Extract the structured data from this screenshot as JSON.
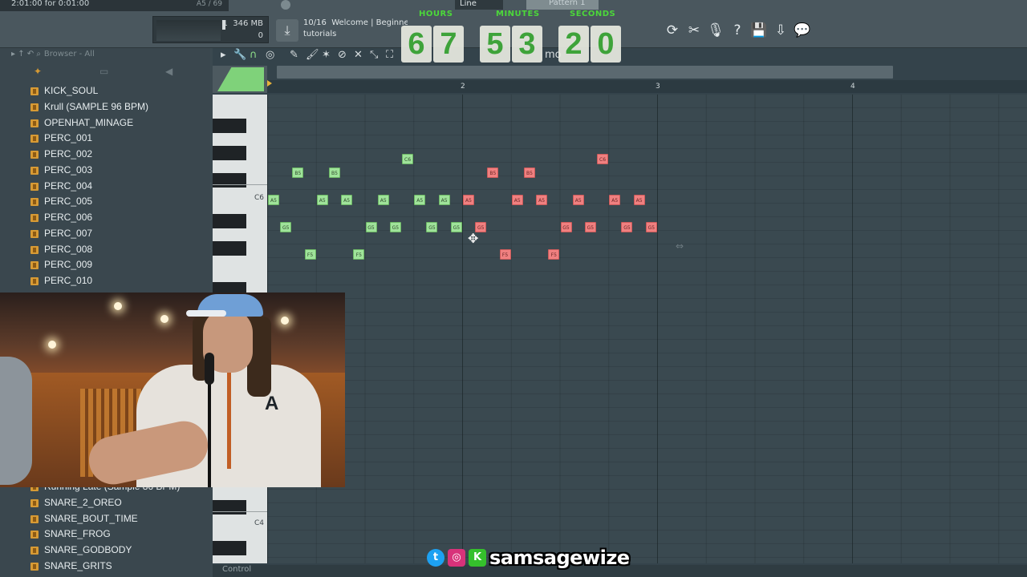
{
  "topbar": {
    "song_position": "2:01:00 for 0:01:00",
    "song_position_right": "A5 / 69",
    "memory": "346 MB",
    "cpu_value": "1",
    "polyphony": "0",
    "hint_counter": "10/16",
    "hint_line1": "Welcome | Beginner",
    "hint_line2": "tutorials",
    "snap_mode": "Line",
    "pattern": "Pattern 1"
  },
  "timer": {
    "hours_label": "HOURS",
    "minutes_label": "MINUTES",
    "seconds_label": "SECONDS",
    "digits": [
      "6",
      "7",
      "5",
      "3",
      "2",
      "0"
    ]
  },
  "toolbar_icons": [
    "reset-icon",
    "cut-icon",
    "mic-icon",
    "help-icon",
    "save-icon",
    "render-icon",
    "chat-icon"
  ],
  "browser": {
    "title": "Browser - All",
    "files_top": [
      "KICK_SOUL",
      "Krull (SAMPLE 96 BPM)",
      "OPENHAT_MINAGE",
      "PERC_001",
      "PERC_002",
      "PERC_003",
      "PERC_004",
      "PERC_005",
      "PERC_006",
      "PERC_007",
      "PERC_008",
      "PERC_009",
      "PERC_010"
    ],
    "files_bottom": [
      "Running Late (Sample 86 BPM)",
      "SNARE_2_OREO",
      "SNARE_BOUT_TIME",
      "SNARE_FROG",
      "SNARE_GODBODY",
      "SNARE_GRITS"
    ]
  },
  "piano_roll": {
    "title_fragment": "mo",
    "bars": [
      "2",
      "3",
      "4"
    ],
    "key_labels": [
      "C6",
      "C4"
    ],
    "bottom_label": "Control",
    "notes": [
      {
        "name": "A5",
        "color": "green",
        "bar": 1.0
      },
      {
        "name": "B5",
        "color": "green",
        "bar": 1.125
      },
      {
        "name": "G5",
        "color": "green",
        "bar": 1.0625
      },
      {
        "name": "F5",
        "color": "green",
        "bar": 1.1875
      },
      {
        "name": "A5",
        "color": "green",
        "bar": 1.25
      },
      {
        "name": "B5",
        "color": "green",
        "bar": 1.3125
      },
      {
        "name": "A5",
        "color": "green",
        "bar": 1.375
      },
      {
        "name": "F5",
        "color": "green",
        "bar": 1.4375
      },
      {
        "name": "G5",
        "color": "green",
        "bar": 1.5
      },
      {
        "name": "A5",
        "color": "green",
        "bar": 1.5625
      },
      {
        "name": "G5",
        "color": "green",
        "bar": 1.625
      },
      {
        "name": "C6",
        "color": "green",
        "bar": 1.6875
      },
      {
        "name": "A5",
        "color": "green",
        "bar": 1.75
      },
      {
        "name": "G5",
        "color": "green",
        "bar": 1.8125
      },
      {
        "name": "A5",
        "color": "green",
        "bar": 1.875
      },
      {
        "name": "G5",
        "color": "green",
        "bar": 1.9375
      },
      {
        "name": "A5",
        "color": "red",
        "bar": 2.0
      },
      {
        "name": "G5",
        "color": "red",
        "bar": 2.0625
      },
      {
        "name": "B5",
        "color": "red",
        "bar": 2.125
      },
      {
        "name": "F5",
        "color": "red",
        "bar": 2.1875
      },
      {
        "name": "A5",
        "color": "red",
        "bar": 2.25
      },
      {
        "name": "B5",
        "color": "red",
        "bar": 2.3125
      },
      {
        "name": "A5",
        "color": "red",
        "bar": 2.375
      },
      {
        "name": "F5",
        "color": "red",
        "bar": 2.4375
      },
      {
        "name": "G5",
        "color": "red",
        "bar": 2.5
      },
      {
        "name": "A5",
        "color": "red",
        "bar": 2.5625
      },
      {
        "name": "G5",
        "color": "red",
        "bar": 2.625
      },
      {
        "name": "C6",
        "color": "red",
        "bar": 2.6875
      },
      {
        "name": "A5",
        "color": "red",
        "bar": 2.75
      },
      {
        "name": "G5",
        "color": "red",
        "bar": 2.8125
      },
      {
        "name": "A5",
        "color": "red",
        "bar": 2.875
      },
      {
        "name": "G5",
        "color": "red",
        "bar": 2.9375
      }
    ]
  },
  "social": {
    "handle": "samsagewize",
    "icons": [
      "twitter-icon",
      "instagram-icon",
      "kick-icon"
    ]
  },
  "colors": {
    "note_green": "#9fe39a",
    "note_red": "#f08080",
    "timer_green": "#3ea33a",
    "folder_orange": "#d79a34"
  }
}
